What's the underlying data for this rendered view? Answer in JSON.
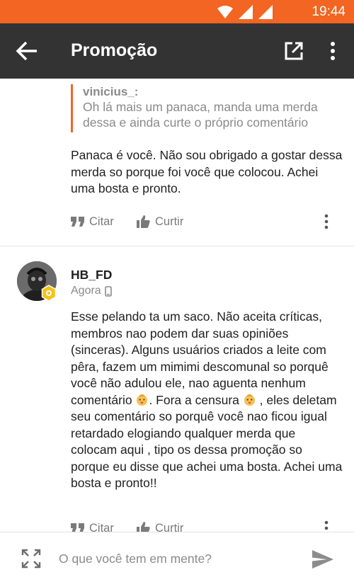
{
  "status_bar": {
    "time": "19:44",
    "icons": [
      "wifi-icon",
      "signal-icon",
      "signal-icon"
    ],
    "color": "#f26522"
  },
  "app_bar": {
    "title": "Promoção",
    "icons": [
      "arrow-back-icon",
      "open-external-icon",
      "more-vert-icon"
    ],
    "color": "#333333"
  },
  "comments": [
    {
      "quote": {
        "author": "vinicius_:",
        "text": "Oh lá mais um panaca, manda uma merda dessa e ainda curte o próprio comentário"
      },
      "text": "Panaca é você. Não sou obrigado a gostar dessa merda so porque foi você que colocou. Achei uma bosta e pronto.",
      "actions": {
        "cite": "Citar",
        "like": "Curtir"
      }
    },
    {
      "author": "HB_FD",
      "time": "Agora",
      "device_icon": "mobile-phone-icon",
      "text_parts": [
        "Esse pelando ta um saco. Não aceita críticas, membros nao podem dar suas opiniões (sinceras). Alguns usuários criados a leite com pêra, fazem um mimimi descomunal so porquê você não adulou ele, nao aguenta nenhum comentário",
        ". Fora a censura",
        ", eles deletam seu comentário so porquê você nao ficou igual retardado elogiando qualquer merda que colocam aqui , tipo os dessa promoção so porque eu disse que achei uma bosta. Achei uma bosta e pronto!!"
      ],
      "emojis": [
        "baby-emoji",
        "baby-emoji"
      ],
      "actions": {
        "cite": "Citar",
        "like": "Curtir"
      }
    }
  ],
  "composer": {
    "placeholder": "O que você tem em mente?",
    "icons": [
      "expand-icon",
      "send-icon"
    ]
  },
  "accent_color": "#f26522"
}
